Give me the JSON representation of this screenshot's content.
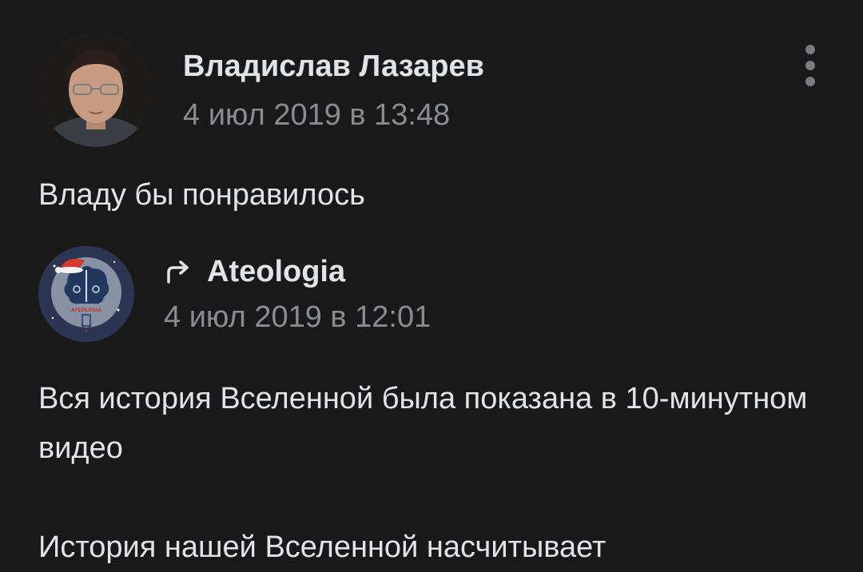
{
  "post": {
    "author": {
      "name": "Владислав Лазарев",
      "date": "4 июл 2019 в 13:48"
    },
    "text": "Владу бы понравилось",
    "repost": {
      "source_name": "Ateologia",
      "date": "4 июл 2019 в 12:01",
      "avatar_label": "ATEOLOGIA",
      "paragraphs": [
        "Вся история Вселенной была показана в 10-минутном видео",
        "История нашей Вселенной насчитывает"
      ]
    }
  },
  "icons": {
    "menu": "more-vertical-icon",
    "repost": "share-arrow-icon"
  },
  "colors": {
    "background": "#19191a",
    "primary_text": "#e1e3e6",
    "secondary_text": "#8a8c90",
    "icon": "#7a7c80"
  }
}
